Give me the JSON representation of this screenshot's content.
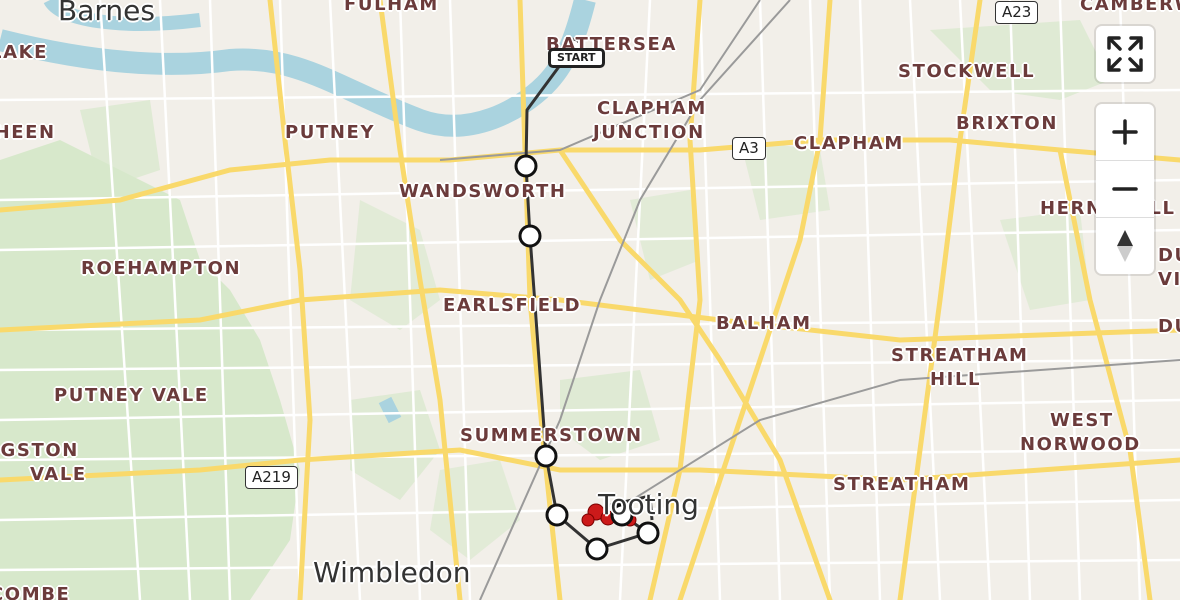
{
  "map": {
    "district_labels": [
      {
        "text": "FULHAM"
      },
      {
        "text": "BATTERSEA"
      },
      {
        "text": "CAMBERWELL"
      },
      {
        "text": "STOCKWELL"
      },
      {
        "text": "PUTNEY"
      },
      {
        "text": "CLAPHAM"
      },
      {
        "text": "JUNCTION"
      },
      {
        "text": "CLAPHAM"
      },
      {
        "text": "BRIXTON"
      },
      {
        "text": "WANDSWORTH"
      },
      {
        "text": "SHEEN"
      },
      {
        "text": "HERNE HILL"
      },
      {
        "text": "ROEHAMPTON"
      },
      {
        "text": "EARLSFIELD"
      },
      {
        "text": "BALHAM"
      },
      {
        "text": "STREATHAM"
      },
      {
        "text": "HILL"
      },
      {
        "text": "PUTNEY VALE"
      },
      {
        "text": "WEST"
      },
      {
        "text": "NORWOOD"
      },
      {
        "text": "SUMMERSTOWN"
      },
      {
        "text": "KINGSTON"
      },
      {
        "text": "VALE"
      },
      {
        "text": "STREATHAM"
      },
      {
        "text": "LAKE"
      },
      {
        "text": "DULWICH"
      },
      {
        "text": "VILLAGE"
      },
      {
        "text": "DULWICH"
      }
    ],
    "town_labels": [
      {
        "text": "Barnes"
      },
      {
        "text": "Tooting"
      },
      {
        "text": "Wimbledon"
      },
      {
        "text": "COMBE"
      }
    ],
    "road_shields": [
      {
        "text": "A23"
      },
      {
        "text": "A3"
      },
      {
        "text": "A219"
      }
    ],
    "start_label": "START",
    "route_waypoints": 9
  },
  "controls": {
    "fullscreen_icon": "fullscreen-icon",
    "zoom_in_icon": "plus-icon",
    "zoom_out_icon": "minus-icon",
    "compass_icon": "compass-icon"
  }
}
